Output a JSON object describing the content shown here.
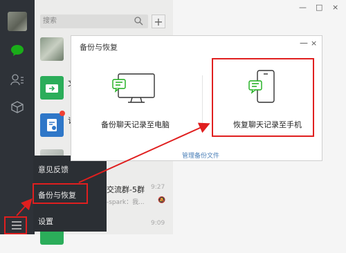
{
  "search": {
    "placeholder": "搜索",
    "add": "+"
  },
  "chats": [
    {
      "title": "",
      "snippet": "",
      "time": ""
    },
    {
      "title": "文",
      "snippet": "",
      "time": ""
    },
    {
      "title": "订",
      "snippet": "",
      "time": ""
    },
    {
      "title": "",
      "snippet": "",
      "time": ""
    },
    {
      "title": "交流群-5群",
      "snippet": "-spark：我...",
      "time": "9:27"
    },
    {
      "title": "",
      "snippet": "",
      "time": "9:09"
    }
  ],
  "popup_menu": {
    "items": [
      "意见反馈",
      "备份与恢复",
      "设置"
    ]
  },
  "dialog": {
    "title": "备份与恢复",
    "minimize": "—",
    "close": "×",
    "option_pc": "备份聊天记录至电脑",
    "option_phone": "恢复聊天记录至手机",
    "manage_link": "管理备份文件"
  },
  "window_controls": [
    "—",
    "□",
    "×"
  ],
  "colors": {
    "highlight": "#e01f1f",
    "sidebar": "#2e3238",
    "wechat_green": "#1aad19",
    "link": "#4a7fb8"
  }
}
